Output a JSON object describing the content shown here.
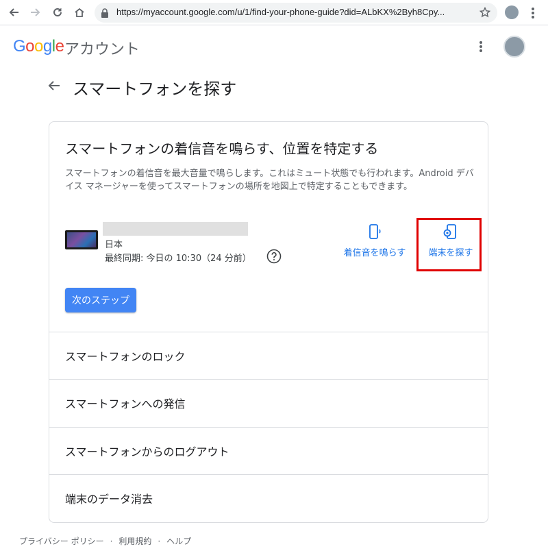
{
  "browser": {
    "url": "https://myaccount.google.com/u/1/find-your-phone-guide?did=ALbKX%2Byh8Cpy..."
  },
  "header": {
    "logo_letters": [
      "G",
      "o",
      "o",
      "g",
      "l",
      "e"
    ],
    "logo_colors": [
      "#4285f4",
      "#ea4335",
      "#fbbc05",
      "#4285f4",
      "#34a853",
      "#ea4335"
    ],
    "account_label": "アカウント"
  },
  "page": {
    "title": "スマートフォンを探す"
  },
  "card": {
    "title": "スマートフォンの着信音を鳴らす、位置を特定する",
    "description": "スマートフォンの着信音を最大音量で鳴らします。これはミュート状態でも行われます。Android デバイス マネージャーを使ってスマートフォンの場所を地図上で特定することもできます。",
    "device": {
      "country": "日本",
      "last_sync": "最終同期: 今日の 10:30（24 分前）"
    },
    "ring_label": "着信音を鳴らす",
    "find_label": "端末を探す",
    "next_button": "次のステップ",
    "options": [
      "スマートフォンのロック",
      "スマートフォンへの発信",
      "スマートフォンからのログアウト",
      "端末のデータ消去"
    ],
    "accent_color": "#1a73e8",
    "highlight_color": "#e00000"
  },
  "footer": {
    "privacy": "プライバシー ポリシー",
    "terms": "利用規約",
    "help": "ヘルプ",
    "separator": "·"
  }
}
